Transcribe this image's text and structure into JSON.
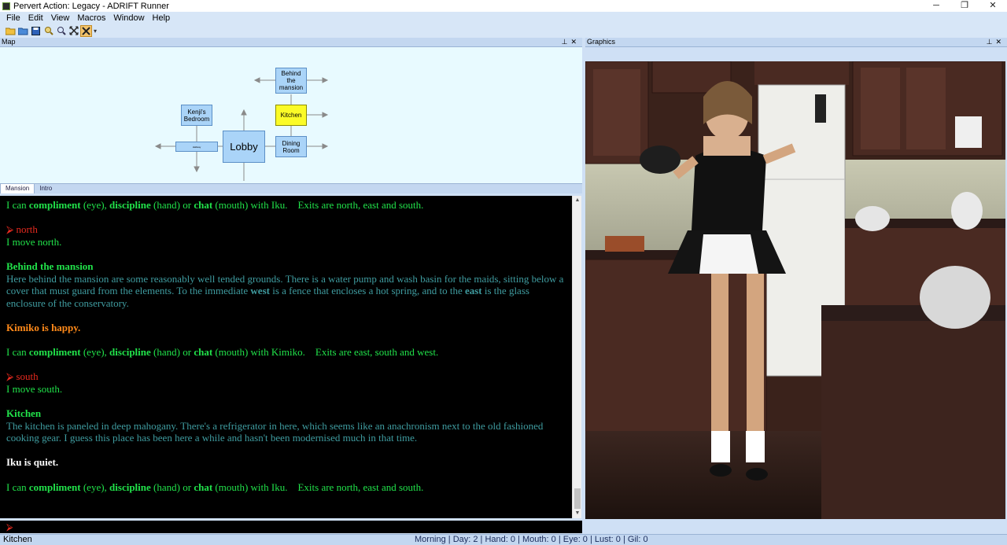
{
  "window": {
    "title": "Pervert Action: Legacy - ADRIFT Runner",
    "minimize": "─",
    "restore": "❐",
    "close": "✕"
  },
  "menu": [
    "File",
    "Edit",
    "View",
    "Macros",
    "Window",
    "Help"
  ],
  "toolbar": {
    "icons": [
      "open-folder-icon",
      "open-file-icon",
      "save-icon",
      "search-icon",
      "zoom-icon",
      "expand-icon",
      "close-tool-icon"
    ]
  },
  "map": {
    "header": "Map",
    "rooms": {
      "behind": "Behind the mansion",
      "kitchen": "Kitchen",
      "kenji": "Kenji's Bedroom",
      "hallway": "Hallway",
      "lobby": "Lobby",
      "dining": "Dining Room"
    },
    "tabs": [
      "Mansion",
      "Intro"
    ]
  },
  "graphics": {
    "header": "Graphics"
  },
  "transcript": {
    "l1": {
      "pre": "I can ",
      "a": "compliment",
      "b": " (eye), ",
      "c": "discipline",
      "d": " (hand) or ",
      "e": "chat",
      "f": " (mouth) with Iku.    Exits are north, east and south."
    },
    "cmd1": "⮚ north",
    "r1": "I move north.",
    "room1_title": "Behind the mansion",
    "room1_desc_a": "Here behind the mansion are some reasonably well tended grounds. There is a water pump and wash basin for the maids, sitting below a cover that must guard from the elements. To the immediate ",
    "room1_west": "west",
    "room1_desc_b": " is a fence that encloses a hot spring, and to the ",
    "room1_east": "east",
    "room1_desc_c": " is the glass enclosure of the conservatory.",
    "mood1": "Kimiko is happy.",
    "l2": {
      "pre": "I can ",
      "a": "compliment",
      "b": " (eye), ",
      "c": "discipline",
      "d": " (hand) or ",
      "e": "chat",
      "f": " (mouth) with Kimiko.    Exits are east, south and west."
    },
    "cmd2": "⮚ south",
    "r2": "I move south.",
    "room2_title": "Kitchen",
    "room2_desc": "The kitchen is paneled in deep mahogany. There's a refrigerator in here, which seems like an anachronism next to the old fashioned cooking gear. I guess this place has been here a while and hasn't been modernised much in that time.",
    "mood2": "Iku is quiet.",
    "l3": {
      "pre": "I can ",
      "a": "compliment",
      "b": " (eye), ",
      "c": "discipline",
      "d": " (hand) or ",
      "e": "chat",
      "f": " (mouth) with Iku.    Exits are north, east and south."
    }
  },
  "input": {
    "prompt": "⮚"
  },
  "status": {
    "location": "Kitchen",
    "stats": "Morning | Day: 2 | Hand: 0 | Mouth: 0 | Eye: 0 | Lust: 0 | Gil: 0"
  }
}
